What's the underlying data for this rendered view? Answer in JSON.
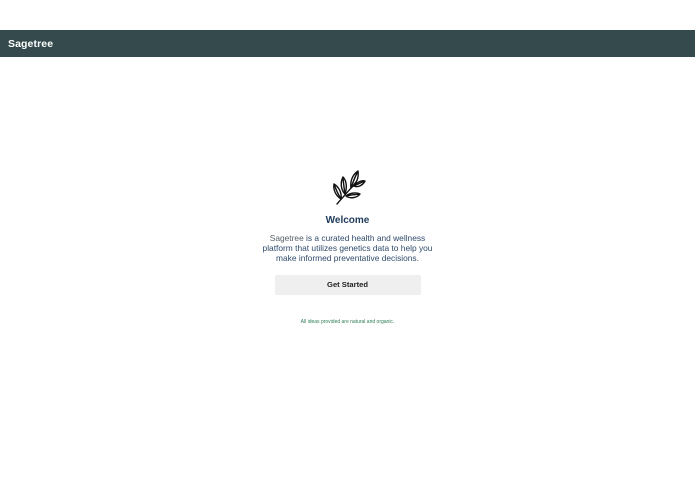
{
  "header": {
    "title": "Sagetree"
  },
  "main": {
    "logo_icon": "sage-leaf-icon",
    "heading": "Welcome",
    "description_brand": "Sagetree",
    "description_rest": " is a curated health and wellness platform that utilizes genetics data to help you make informed preventative decisions.",
    "cta_label": "Get Started",
    "footnote": "All ideas provided are natural and organic."
  },
  "colors": {
    "header_bg": "#344a4c",
    "heading": "#1f3b5c",
    "button_bg": "#efefef",
    "footnote": "#2e7d55"
  }
}
